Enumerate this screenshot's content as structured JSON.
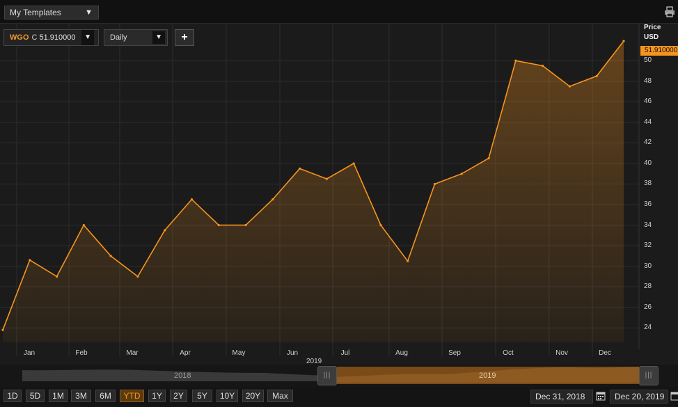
{
  "header": {
    "templates_label": "My Templates"
  },
  "toolbar": {
    "ticker": "WGO",
    "close_tag": "C",
    "last_price": "51.910000",
    "frequency": "Daily",
    "add_label": "+"
  },
  "axis": {
    "price_title": "Price",
    "currency": "USD",
    "last_value_tag": "51.910000",
    "year_label": "2019"
  },
  "navigator": {
    "left_label": "2018",
    "right_label": "2019"
  },
  "range_buttons": [
    "1D",
    "5D",
    "1M",
    "3M",
    "6M",
    "YTD",
    "1Y",
    "2Y",
    "5Y",
    "10Y",
    "20Y",
    "Max"
  ],
  "active_range": "YTD",
  "dates": {
    "start": "Dec 31, 2018",
    "end": "Dec 20, 2019"
  },
  "colors": {
    "line": "#f7941d",
    "tag": "#f7941d",
    "grid": "#2e2e2e"
  },
  "chart_data": {
    "type": "area",
    "series": [
      {
        "x": [
          "Dec 31, 2018",
          "Jan 15",
          "Feb 1",
          "Feb 15",
          "Mar 1",
          "Mar 15",
          "Apr 1",
          "Apr 15",
          "May 1",
          "May 15",
          "Jun 1",
          "Jun 15",
          "Jul 1",
          "Jul 15",
          "Aug 1",
          "Aug 15",
          "Sep 1",
          "Sep 15",
          "Oct 1",
          "Oct 15",
          "Nov 1",
          "Nov 15",
          "Dec 1",
          "Dec 20, 2019"
        ],
        "values": [
          23.8,
          30.6,
          29.0,
          34.0,
          31.0,
          29.0,
          33.5,
          36.5,
          34.0,
          34.0,
          36.5,
          39.5,
          38.5,
          40.0,
          34.0,
          30.5,
          38.0,
          39.0,
          40.5,
          50.0,
          49.5,
          47.5,
          48.5,
          51.91
        ]
      }
    ],
    "x_tick_labels": [
      "Jan",
      "Feb",
      "Mar",
      "Apr",
      "May",
      "Jun",
      "Jul",
      "Aug",
      "Sep",
      "Oct",
      "Nov",
      "Dec"
    ],
    "y_ticks": [
      24,
      26,
      28,
      30,
      32,
      34,
      36,
      38,
      40,
      42,
      44,
      46,
      48,
      50
    ],
    "ylim": [
      22.6,
      53.6
    ],
    "ylabel": "Price USD",
    "grid": true,
    "legend": "none"
  }
}
